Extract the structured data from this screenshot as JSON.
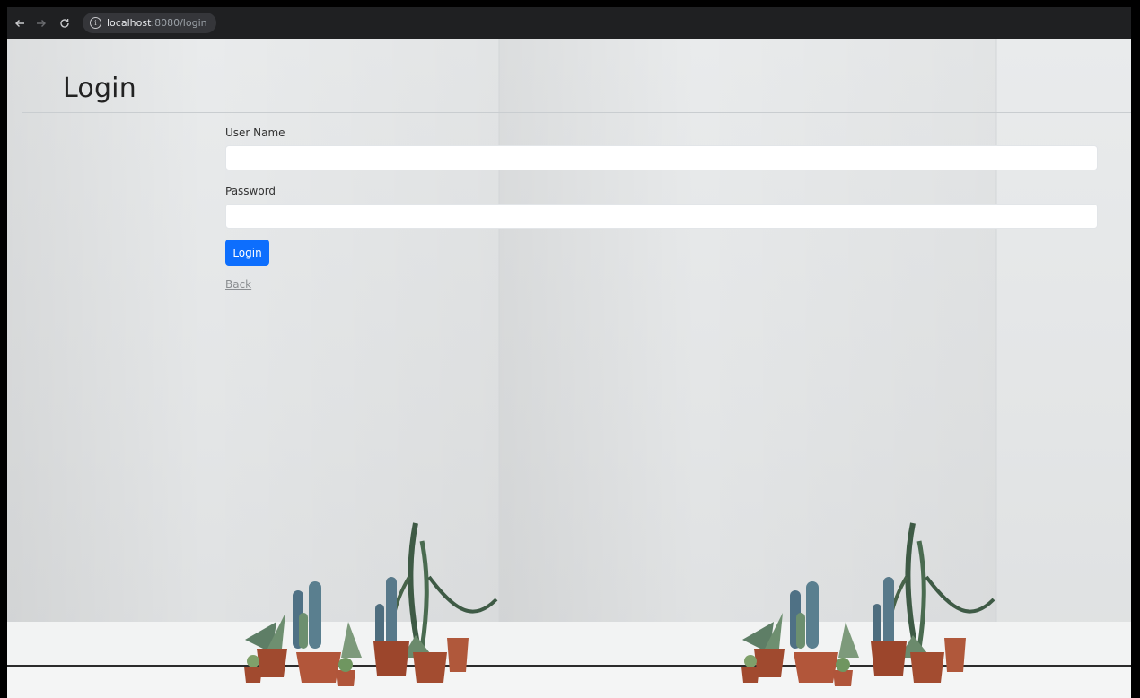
{
  "browser": {
    "nav": {
      "back_icon": "arrow-left-icon",
      "forward_icon": "arrow-right-icon",
      "reload_icon": "reload-icon"
    },
    "address_bar": {
      "icon": "info-icon",
      "host": "localhost",
      "path": ":8080/login"
    }
  },
  "page": {
    "title": "Login",
    "form": {
      "username_label": "User Name",
      "username_value": "",
      "password_label": "Password",
      "password_value": "",
      "submit_label": "Login",
      "back_link": "Back"
    }
  },
  "colors": {
    "primary": "#0d6efd",
    "link_muted": "#8a8d90",
    "chrome_bg": "#1f2022"
  }
}
